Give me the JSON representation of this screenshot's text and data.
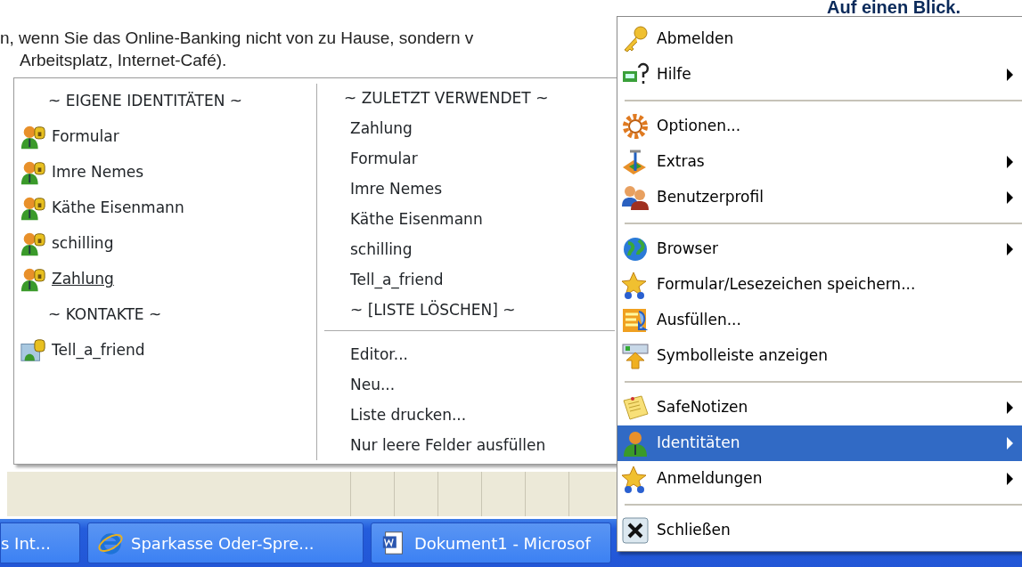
{
  "page": {
    "lines": [
      "n, wenn Sie das Online-Banking nicht von zu Hause, sondern v",
      "Arbeitsplatz, Internet-Café)."
    ],
    "side_heading": "Auf einen Blick."
  },
  "identities_menu": {
    "left": [
      {
        "kind": "header",
        "label": "~ EIGENE IDENTITÄTEN ~"
      },
      {
        "kind": "identity",
        "label": "Formular",
        "hovered": false
      },
      {
        "kind": "identity",
        "label": "Imre Nemes",
        "hovered": false
      },
      {
        "kind": "identity",
        "label": "Käthe Eisenmann",
        "hovered": false
      },
      {
        "kind": "identity",
        "label": "schilling",
        "hovered": false
      },
      {
        "kind": "identity",
        "label": "Zahlung",
        "hovered": true
      },
      {
        "kind": "header",
        "label": "~ KONTAKTE ~"
      },
      {
        "kind": "contact",
        "label": "Tell_a_friend",
        "hovered": false
      }
    ],
    "right": [
      {
        "kind": "header",
        "label": "~ ZULETZT VERWENDET ~"
      },
      {
        "kind": "item",
        "label": "Zahlung"
      },
      {
        "kind": "item",
        "label": "Formular"
      },
      {
        "kind": "item",
        "label": "Imre Nemes"
      },
      {
        "kind": "item",
        "label": "Käthe Eisenmann"
      },
      {
        "kind": "item",
        "label": "schilling"
      },
      {
        "kind": "item",
        "label": "Tell_a_friend"
      },
      {
        "kind": "item",
        "label": "~ [LISTE LÖSCHEN] ~"
      },
      {
        "kind": "separator"
      },
      {
        "kind": "item",
        "label": "Editor..."
      },
      {
        "kind": "item",
        "label": "Neu..."
      },
      {
        "kind": "item",
        "label": "Liste drucken..."
      },
      {
        "kind": "item",
        "label": "Nur leere Felder ausfüllen"
      }
    ]
  },
  "main_menu": {
    "items": [
      {
        "kind": "item",
        "label": "Abmelden",
        "submenu": false,
        "selected": false
      },
      {
        "kind": "item",
        "label": "Hilfe",
        "submenu": true,
        "selected": false
      },
      {
        "kind": "separator"
      },
      {
        "kind": "item",
        "label": "Optionen...",
        "submenu": false,
        "selected": false
      },
      {
        "kind": "item",
        "label": "Extras",
        "submenu": true,
        "selected": false
      },
      {
        "kind": "item",
        "label": "Benutzerprofil",
        "submenu": true,
        "selected": false
      },
      {
        "kind": "separator"
      },
      {
        "kind": "item",
        "label": "Browser",
        "submenu": true,
        "selected": false
      },
      {
        "kind": "item",
        "label": "Formular/Lesezeichen speichern...",
        "submenu": false,
        "selected": false
      },
      {
        "kind": "item",
        "label": "Ausfüllen...",
        "submenu": false,
        "selected": false
      },
      {
        "kind": "item",
        "label": "Symbolleiste anzeigen",
        "submenu": false,
        "selected": false
      },
      {
        "kind": "separator"
      },
      {
        "kind": "item",
        "label": "SafeNotizen",
        "submenu": true,
        "selected": false
      },
      {
        "kind": "item",
        "label": "Identitäten",
        "submenu": true,
        "selected": true
      },
      {
        "kind": "item",
        "label": "Anmeldungen",
        "submenu": true,
        "selected": false
      },
      {
        "kind": "separator"
      },
      {
        "kind": "item",
        "label": "Schließen",
        "submenu": false,
        "selected": false
      }
    ]
  },
  "taskbar": {
    "buttons": [
      {
        "label": "s Int..."
      },
      {
        "label": "Sparkasse Oder-Spre..."
      },
      {
        "label": "Dokument1 - Microsof"
      }
    ]
  }
}
